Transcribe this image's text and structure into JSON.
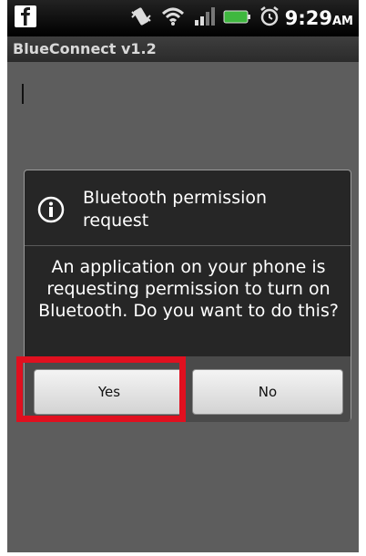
{
  "status_bar": {
    "time": "9:29",
    "ampm": "AM",
    "icons": [
      "vibrate-icon",
      "wifi-icon",
      "signal-icon",
      "battery-icon",
      "alarm-icon"
    ],
    "app_notification_icon": "facebook-icon"
  },
  "app": {
    "title": "BlueConnect v1.2"
  },
  "dialog": {
    "title": "Bluetooth permission request",
    "message": "An application on your phone is requesting permission to turn on Bluetooth. Do you want to do this?",
    "yes_label": "Yes",
    "no_label": "No",
    "icon": "info-icon"
  },
  "colors": {
    "highlight": "#e0101f",
    "battery": "#3fb83f"
  }
}
